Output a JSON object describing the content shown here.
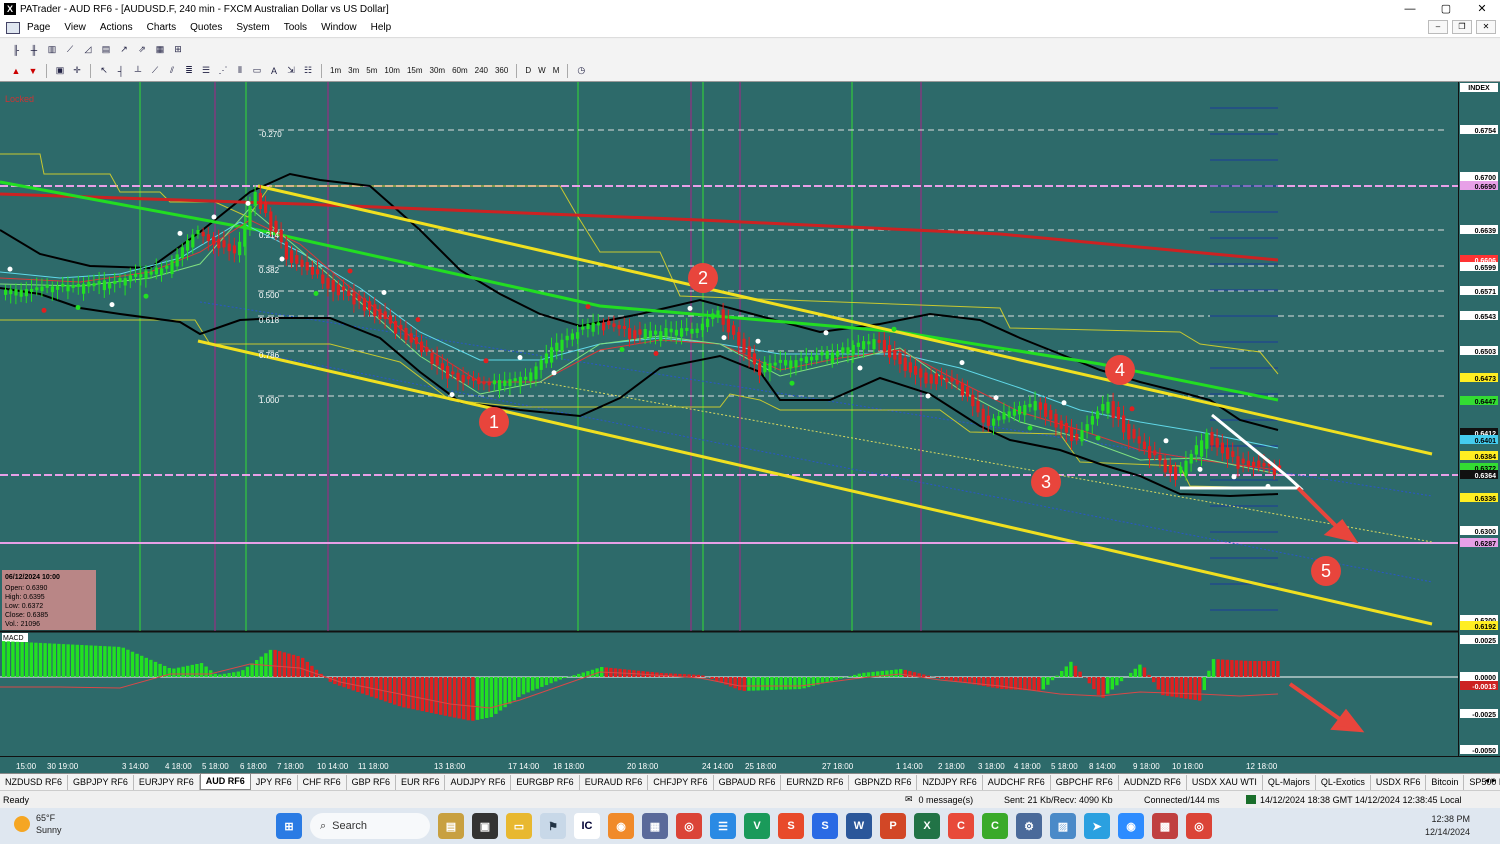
{
  "window": {
    "title": "PATrader - AUD RF6 - [AUDUSD.F, 240 min - FXCM Australian Dollar vs US Dollar]",
    "app_icon": "X"
  },
  "menu": [
    "Page",
    "View",
    "Actions",
    "Charts",
    "Quotes",
    "System",
    "Tools",
    "Window",
    "Help"
  ],
  "timeframes": [
    "1m",
    "3m",
    "5m",
    "10m",
    "15m",
    "30m",
    "60m",
    "240",
    "360",
    "D",
    "W",
    "M"
  ],
  "chart": {
    "locked_label": "Locked",
    "index_label": "INDEX",
    "macd_label": "MACD",
    "price_labels": [
      "0.6754",
      "0.6700",
      "0.6690",
      "0.6639",
      "0.6606",
      "0.6599",
      "0.6571",
      "0.6543",
      "0.6503",
      "0.6473",
      "0.6447",
      "0.6412",
      "0.6401",
      "0.6384",
      "0.6372",
      "0.6364",
      "0.6336",
      "0.6300",
      "0.6287",
      "0.6200",
      "0.6192"
    ],
    "macd_labels": [
      "0.0025",
      "0.0000",
      "-0.0013",
      "-0.0025",
      "-0.0050"
    ],
    "fib_labels": [
      "-0.270",
      "0.214",
      "0.382",
      "0.500",
      "0.618",
      "0.786",
      "1.000"
    ],
    "time_labels": [
      "15:00",
      "30 19:00",
      "3 14:00",
      "4 18:00",
      "5 18:00",
      "6 18:00",
      "7 18:00",
      "10 14:00",
      "11 18:00",
      "13 18:00",
      "17 14:00",
      "18 18:00",
      "20 18:00",
      "24 14:00",
      "25 18:00",
      "27 18:00",
      "1 14:00",
      "2 18:00",
      "3 18:00",
      "4 18:00",
      "5 18:00",
      "8 14:00",
      "9 18:00",
      "10 18:00",
      "12 18:00"
    ],
    "ohlc": {
      "date": "06/12/2024 10:00",
      "open": "Open: 0.6390",
      "high": "High: 0.6395",
      "low": "Low: 0.6372",
      "close": "Close: 0.6385",
      "vol": "Vol.: 21096"
    },
    "markers": [
      "1",
      "2",
      "3",
      "4",
      "5"
    ],
    "colors": {
      "bg": "#2d6a6a",
      "up": "#22e022",
      "down": "#e02020",
      "channel": "#f0e020",
      "fib_line": "#e090e0",
      "ma_red": "#cc2222",
      "ma_green": "#22dd22"
    }
  },
  "tabs": [
    "NZDUSD RF6",
    "GBPJPY RF6",
    "EURJPY RF6",
    "AUD RF6",
    "JPY RF6",
    "CHF RF6",
    "GBP RF6",
    "EUR RF6",
    "AUDJPY RF6",
    "EURGBP RF6",
    "EURAUD RF6",
    "CHFJPY RF6",
    "GBPAUD RF6",
    "EURNZD RF6",
    "GBPNZD RF6",
    "NZDJPY RF6",
    "AUDCHF RF6",
    "GBPCHF RF6",
    "AUDNZD RF6",
    "USDX XAU WTI",
    "QL-Majors",
    "QL-Exotics",
    "USDX RF6",
    "Bitcoin",
    "SP500 RF6",
    "DJIA"
  ],
  "active_tab": "AUD RF6",
  "status": {
    "ready": "Ready",
    "messages": "0 message(s)",
    "sent": "Sent: 21 Kb/Recv: 4090 Kb",
    "connected": "Connected/144 ms",
    "time": "14/12/2024 18:38 GMT  14/12/2024 12:38:45 Local"
  },
  "taskbar": {
    "temp": "65°F",
    "weather": "Sunny",
    "search": "Search",
    "clock_time": "12:38 PM",
    "clock_date": "12/14/2024"
  }
}
